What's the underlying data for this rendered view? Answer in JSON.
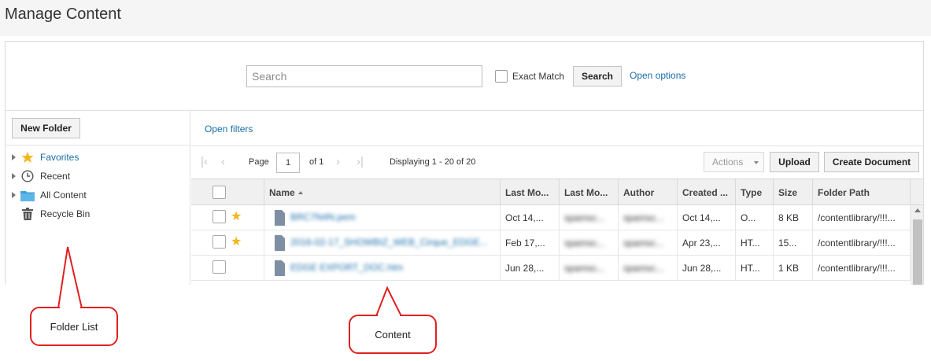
{
  "page": {
    "title": "Manage Content"
  },
  "search": {
    "placeholder": "Search",
    "value": "",
    "exact_match_label": "Exact Match",
    "exact_match_checked": false,
    "button_label": "Search",
    "open_options_label": "Open options"
  },
  "sidebar": {
    "new_folder_label": "New Folder",
    "items": [
      {
        "label": "Favorites",
        "icon": "star-icon",
        "expandable": true,
        "selected": true
      },
      {
        "label": "Recent",
        "icon": "clock-icon",
        "expandable": true,
        "selected": false
      },
      {
        "label": "All Content",
        "icon": "folder-icon",
        "expandable": true,
        "selected": false
      },
      {
        "label": "Recycle Bin",
        "icon": "trash-icon",
        "expandable": false,
        "selected": false
      }
    ]
  },
  "content": {
    "open_filters_label": "Open filters",
    "pagination": {
      "page_label": "Page",
      "current_page": "1",
      "of_label": "of 1",
      "displaying": "Displaying 1 - 20 of 20"
    },
    "toolbar": {
      "actions_label": "Actions",
      "upload_label": "Upload",
      "create_document_label": "Create Document"
    },
    "table": {
      "columns": [
        "Name",
        "Last Mo...",
        "Last Mo...",
        "Author",
        "Created ...",
        "Type",
        "Size",
        "Folder Path"
      ],
      "sorted_by": "Name",
      "sort_direction": "ascending",
      "rows": [
        {
          "starred": true,
          "file_type_badge": "OTHR",
          "name": "BRC7N4N.pem",
          "last_modified": "Oct 14,...",
          "last_modified_by": "spamsc...",
          "author": "spamsc...",
          "created": "Oct 14,...",
          "type": "O...",
          "size": "8 KB",
          "folder_path": "/contentlibrary/!!!..."
        },
        {
          "starred": true,
          "file_type_badge": "HTML",
          "name": "2016-02-17_SHOWBIZ_WEB_Cirque_EDGE...",
          "last_modified": "Feb 17,...",
          "last_modified_by": "spamsc...",
          "author": "spamsc...",
          "created": "Apr 23,...",
          "type": "HT...",
          "size": "15...",
          "folder_path": "/contentlibrary/!!!..."
        },
        {
          "starred": false,
          "file_type_badge": "HTML",
          "name": "EDGE EXPORT_DOC.htm",
          "last_modified": "Jun 28,...",
          "last_modified_by": "spamsc...",
          "author": "spamsc...",
          "created": "Jun 28,...",
          "type": "HT...",
          "size": "1 KB",
          "folder_path": "/contentlibrary/!!!..."
        }
      ]
    }
  },
  "annotations": {
    "folder_list_label": "Folder List",
    "content_label": "Content",
    "color": "#e02020"
  }
}
